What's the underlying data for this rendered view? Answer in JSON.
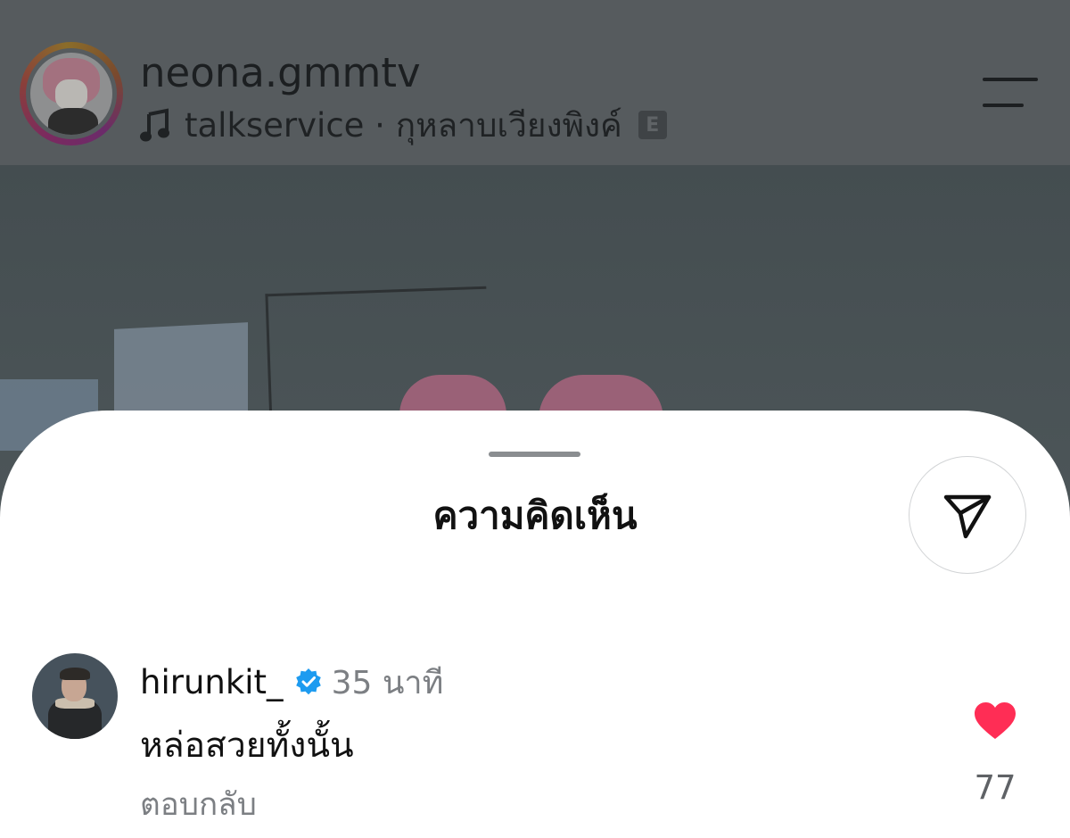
{
  "post_header": {
    "username": "neona.gmmtv",
    "audio_text": "talkservice · กุหลาบเวียงพิงค์",
    "explicit_badge": "E"
  },
  "comments_sheet": {
    "title": "ความคิดเห็น",
    "comments": [
      {
        "username": "hirunkit_",
        "verified": true,
        "time": "35 นาที",
        "text": "หล่อสวยทั้งนั้น",
        "reply_label": "ตอบกลับ",
        "like_count": "77",
        "liked": true
      }
    ]
  },
  "colors": {
    "like_red": "#ff2d55",
    "verified_blue": "#1d9bf0",
    "sheet_bg": "#ffffff"
  },
  "icons": {
    "music": "music-note-icon",
    "menu": "menu-icon",
    "share": "send-icon",
    "verified": "verified-icon",
    "like": "heart-icon"
  }
}
